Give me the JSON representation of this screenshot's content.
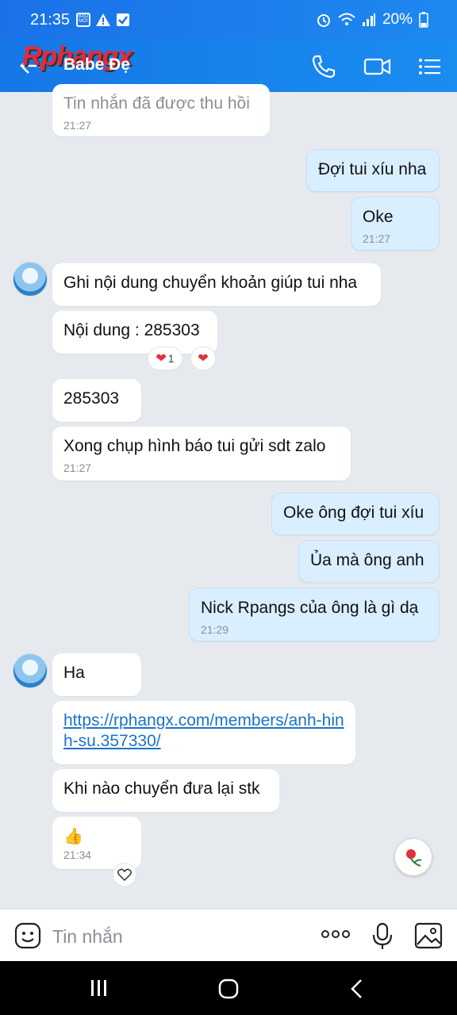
{
  "status": {
    "time": "21:35",
    "battery": "20%",
    "icons": [
      "bao-moi-icon",
      "warning-icon",
      "check-box-icon",
      "alarm-icon",
      "wifi-icon",
      "signal-icon",
      "battery-icon"
    ]
  },
  "watermark": "Rphangx",
  "header": {
    "title": "Babe Đẹ",
    "icons": [
      "back-arrow-icon",
      "phone-icon",
      "video-call-icon",
      "menu-list-icon"
    ]
  },
  "messages": [
    {
      "text": "Tin nhắn đã được thu hồi",
      "time": "21:27"
    },
    {
      "text": "Đợi tui xíu nha"
    },
    {
      "text": "Oke",
      "time": "21:27"
    },
    {
      "text": "Ghi nội dung chuyển khoản giúp tui nha"
    },
    {
      "text": "Nội dung : 285303",
      "reaction_count": "1"
    },
    {
      "text": "285303"
    },
    {
      "text": "Xong chụp hình báo tui gửi sdt zalo",
      "time": "21:27"
    },
    {
      "text": "Oke ông đợi tui xíu"
    },
    {
      "text": "Ủa mà ông anh"
    },
    {
      "text": "Nick Rpangs của ông là gì dạ",
      "time": "21:29"
    },
    {
      "text": "Ha"
    },
    {
      "text": "https://rphangx.com/members/anh-hinh-su.357330/"
    },
    {
      "text": "Khi nào chuyển đưa lại stk"
    },
    {
      "text": "👍",
      "time": "21:34"
    }
  ],
  "input": {
    "placeholder": "Tin nhắn",
    "icons": [
      "sticker-icon",
      "more-icon",
      "microphone-icon",
      "image-icon"
    ]
  },
  "nav": {
    "icons": [
      "recent-apps-icon",
      "home-icon",
      "back-icon"
    ]
  },
  "colors": {
    "header": "#1a82ee",
    "outgoing": "#d9efff",
    "incoming": "#ffffff",
    "background": "#e6eaef",
    "link": "#1a73c9"
  }
}
